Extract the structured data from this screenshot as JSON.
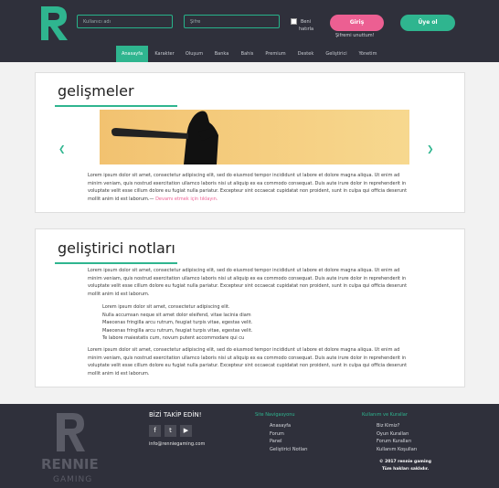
{
  "header": {
    "username_placeholder": "Kullanıcı adı",
    "password_placeholder": "Şifre",
    "remember_label_1": "Beni",
    "remember_label_2": "hatırla",
    "login_label": "Giriş",
    "forgot_label": "Şifremi unuttum!",
    "signup_label": "Üye ol"
  },
  "nav": {
    "items": [
      {
        "label": "Anasayfa",
        "active": true
      },
      {
        "label": "Karakter"
      },
      {
        "label": "Oluşum"
      },
      {
        "label": "Banka"
      },
      {
        "label": "Bahis"
      },
      {
        "label": "Premium"
      },
      {
        "label": "Destek"
      },
      {
        "label": "Geliştirici"
      },
      {
        "label": "Yönetim"
      }
    ]
  },
  "news": {
    "title": "gelişmeler",
    "paragraph": "Lorem ipsum dolor sit amet, consectetur adipiscing elit, sed do eiusmod tempor incididunt ut labore et dolore magna aliqua. Ut enim ad minim veniam, quis nostrud exercitation ullamco laboris nisi ut aliquip ex ea commodo consequat. Duis aute irure dolor in reprehenderit in voluptate velit esse cillum dolore eu fugiat nulla pariatur. Excepteur sint occaecat cupidatat non proident, sunt in culpa qui officia deserunt mollit anim id est laborum.—",
    "read_more": "Devamı etmek için tıklayın."
  },
  "devnotes": {
    "title": "geliştirici notları",
    "paragraph_1": "Lorem ipsum dolor sit amet, consectetur adipiscing elit, sed do eiusmod tempor incididunt ut labore et dolore magna aliqua. Ut enim ad minim veniam, quis nostrud exercitation ullamco laboris nisi ut aliquip ex ea commodo consequat. Duis aute irure dolor in reprehenderit in voluptate velit esse cillum dolore eu fugiat nulla pariatur. Excepteur sint occaecat cupidatat non proident, sunt in culpa qui officia deserunt mollit anim id est laborum.",
    "list": [
      "Lorem ipsum dolor sit amet, consectetur adipiscing elit.",
      "Nulla accumsan neque sit amet dolor eleifend, vitae lacinia diam",
      "Maecenas fringilla arcu rutrum, feugiat turpis vitae, egestas velit.",
      "Maecenas fringilla arcu rutrum, feugiat turpis vitae, egestas velit.",
      "Te labore maiestatis cum, novum putent accommodare qui cu"
    ],
    "paragraph_2": "Lorem ipsum dolor sit amet, consectetur adipiscing elit, sed do eiusmod tempor incididunt ut labore et dolore magna aliqua. Ut enim ad minim veniam, quis nostrud exercitation ullamco laboris nisi ut aliquip ex ea commodo consequat. Duis aute irure dolor in reprehenderit in voluptate velit esse cillum dolore eu fugiat nulla pariatur. Excepteur sint occaecat cupidatat non proident, sunt in culpa qui officia deserunt mollit anim id est laborum."
  },
  "footer": {
    "logo_text_1": "RENNIE",
    "logo_text_2": "GAMING",
    "follow_title": "BİZİ TAKİP EDİN!",
    "socials": [
      "f",
      "t",
      "▶"
    ],
    "email": "info@renniegaming.com",
    "nav_title": "Site Navigasyonu",
    "nav_links": [
      "Anasayfa",
      "Forum",
      "Panel",
      "Geliştirici Notları"
    ],
    "rules_title": "Kullanım ve Kurallar",
    "rules_links": [
      "Biz Kimiz?",
      "Oyun Kuralları",
      "Forum Kuralları",
      "Kullanım Koşulları"
    ],
    "copyright_1": "© 2017 rennie gaming",
    "copyright_2": "Tüm hakları saklıdır."
  },
  "colors": {
    "accent": "#2fb58f",
    "pink": "#ec5f92",
    "dark": "#2f303b"
  }
}
